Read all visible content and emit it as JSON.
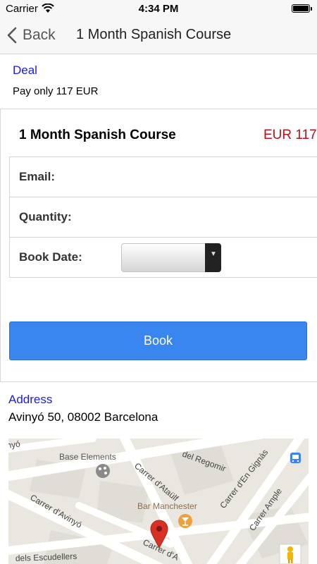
{
  "status_bar": {
    "carrier": "Carrier",
    "time": "4:34 PM"
  },
  "nav": {
    "back_label": "Back",
    "title": "1 Month Spanish Course"
  },
  "deal": {
    "label": "Deal",
    "text": "Pay only 117 EUR"
  },
  "booking": {
    "course_name": "1 Month Spanish Course",
    "price": "EUR 117",
    "email_label": "Email:",
    "email_value": "",
    "quantity_label": "Quantity:",
    "quantity_value": "",
    "book_date_label": "Book Date:",
    "book_date_value": "",
    "book_button": "Book"
  },
  "address": {
    "label": "Address",
    "text": "Avinyó 50, 08002 Barcelona"
  },
  "map": {
    "streets": {
      "regomir": "del Regomir",
      "ataulf": "Carrer d'Ataülf",
      "en_gignas": "Carrer d'En Gignàs",
      "ample": "Carrer Ample",
      "avinyo": "Carrer d'Avinyó",
      "escudellers": "dels Escudellers",
      "avinyo_cut": "Carrer d'A",
      "nyo_cut": "nyó"
    },
    "pois": {
      "base_elements": "Base Elements",
      "bar_manchester": "Bar Manchester"
    },
    "pin_color": "#d93025"
  },
  "colors": {
    "link_blue": "#1a1aee",
    "price_red": "#b5141a",
    "button_blue": "#3a86f0"
  }
}
